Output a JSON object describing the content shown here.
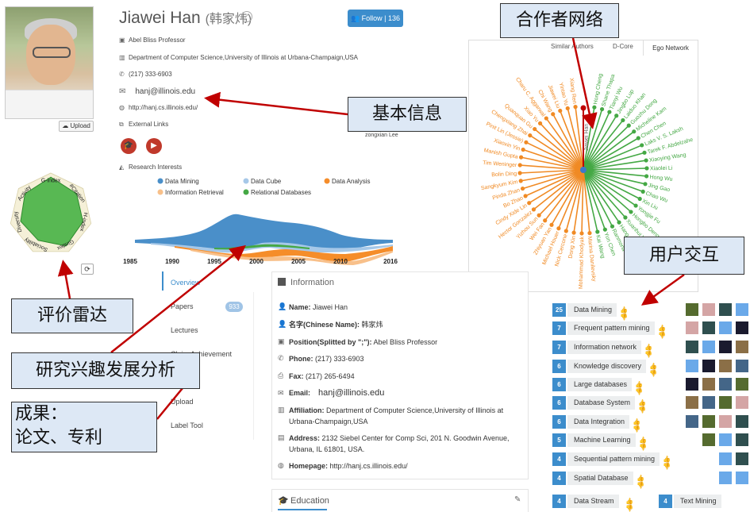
{
  "profile": {
    "name": "Jiawei Han",
    "name_cn": "(韩家炜)",
    "follow_label": "Follow",
    "follow_count": "136",
    "title": "Abel Bliss Professor",
    "department": "Department of Computer Science,University of Illinois at Urbana-Champaign,USA",
    "phone": "(217) 333-6903",
    "email": "hanj@illinois.edu",
    "homepage": "http://hanj.cs.illinois.edu/",
    "external_links": "External Links",
    "upload": "Upload",
    "ego_label": "zongxian Lee"
  },
  "research": {
    "title": "Research Interests",
    "legend": [
      {
        "name": "Data Mining",
        "color": "#4a8fc9"
      },
      {
        "name": "Data Cube",
        "color": "#a6c8e8"
      },
      {
        "name": "Data Analysis",
        "color": "#f58d2a"
      },
      {
        "name": "Information Retrieval",
        "color": "#f8c08a"
      },
      {
        "name": "Relational Databases",
        "color": "#44a844"
      }
    ],
    "years": [
      "1985",
      "1990",
      "1995",
      "2000",
      "2005",
      "2010",
      "2016"
    ]
  },
  "radar": {
    "axes": [
      "G-index",
      "#Citation",
      "H-index",
      "Gindex",
      "Sociability",
      "Diversity",
      "Activity"
    ],
    "values": [
      0.9,
      0.8,
      0.8,
      0.85,
      0.7,
      0.75,
      0.8
    ]
  },
  "ego": {
    "tabs": [
      "Similar Authors",
      "D-Core",
      "Ego Network"
    ],
    "center": "Jiawei Han",
    "green_nodes": [
      "Hong Cheng",
      "Shane Thapa",
      "Tianyi Wu",
      "Jingbo Lup",
      "Laiduo Khan",
      "Guozhu Dong",
      "Micheline Kam",
      "Chen Chen",
      "Laks V. S. Laksh",
      "Tarek F. Abdelzahe",
      "Xiaoying Wang",
      "Xiaolei Li",
      "Hong Wu",
      "Jing Gao",
      "Chao Wu",
      "Xin Liu",
      "Yongjie Fu",
      "Hongbo Deng",
      "Xuanhui Wang",
      "Hang-Gil Lee",
      "Ranmona T. Ng",
      "Yun Chen",
      "Kai Wang"
    ],
    "orange_nodes": [
      "Marina Danilevsky",
      "Mohammad Khodyak",
      "Dong Xin",
      "Nick Cercone",
      "Michael Houer",
      "Zhiyuan Yan",
      "Wei Fan",
      "Yizhou Sun",
      "Hector Gonzalez",
      "Cindy Xide Lin",
      "Bo Zhao",
      "Pinda Zhan",
      "Sangkyum Kim",
      "Bolin Ding",
      "Tim Weninger",
      "Manish Gupta",
      "Xiaoxin Yin",
      "Pinit Lin (Jessie)",
      "Chengxiang Zhai",
      "Quanquan Gu",
      "Xiao Yu",
      "Charu C. Aggarwal",
      "Chi Wang",
      "Jiawei Liu",
      "Yintao Yu",
      "Xiang Ren"
    ]
  },
  "nav": {
    "items": [
      "Overview",
      "Papers",
      "Lectures",
      "Claim Achievement",
      "Upload",
      "Label Tool"
    ],
    "papers_count": "933"
  },
  "info": {
    "title": "Information",
    "name_label": "Name:",
    "name_value": "Jiawei Han",
    "cn_label": "名字(Chinese Name):",
    "cn_value": "韩家炜",
    "pos_label": "Position(Splitted by \";\"):",
    "pos_value": "Abel Bliss Professor",
    "phone_label": "Phone:",
    "phone_value": "(217) 333-6903",
    "fax_label": "Fax:",
    "fax_value": "(217) 265-6494",
    "email_label": "Email:",
    "email_value": "hanj@illinois.edu",
    "aff_label": "Affiliation:",
    "aff_value": "Department of Computer Science,University of Illinois at Urbana-Champaign,USA",
    "addr_label": "Address:",
    "addr_value": "2132 Siebel Center for Comp Sci, 201 N. Goodwin Avenue, Urbana, IL 61801, USA.",
    "home_label": "Homepage:",
    "home_value": "http://hanj.cs.illinois.edu/"
  },
  "education": {
    "title": "Education"
  },
  "interests": [
    {
      "count": "25",
      "label": "Data Mining"
    },
    {
      "count": "7",
      "label": "Frequent pattern mining"
    },
    {
      "count": "7",
      "label": "Information network"
    },
    {
      "count": "6",
      "label": "Knowledge discovery"
    },
    {
      "count": "6",
      "label": "Large databases"
    },
    {
      "count": "6",
      "label": "Database System"
    },
    {
      "count": "6",
      "label": "Data Integration"
    },
    {
      "count": "5",
      "label": "Machine Learning"
    },
    {
      "count": "4",
      "label": "Sequential pattern mining"
    },
    {
      "count": "4",
      "label": "Spatial Database"
    },
    {
      "count": "4",
      "label": "Data Stream"
    },
    {
      "count": "4",
      "label": "Text Mining"
    }
  ],
  "annotations": {
    "collab": "合作者网络",
    "basic": "基本信息",
    "radar": "评价雷达",
    "interest": "研究兴趣发展分析",
    "results": "成果：\n论文、专利",
    "interaction": "用户交互"
  }
}
